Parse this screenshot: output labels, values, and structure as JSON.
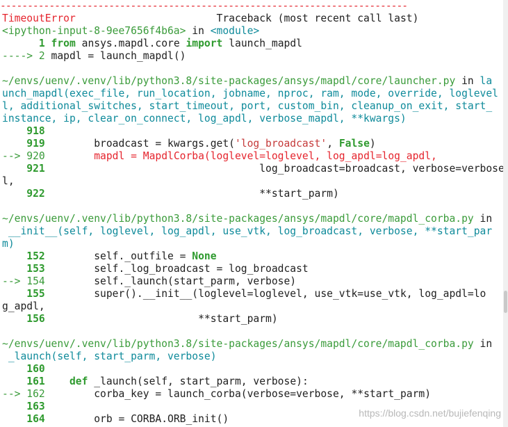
{
  "separator": "---------------------------------------------------------------------------",
  "header": {
    "error_name": "TimeoutError",
    "traceback_label": "Traceback (most recent call last)"
  },
  "frame0": {
    "location": "<ipython-input-8-9ee7656f4b6a>",
    "in_word": " in ",
    "func": "<module>",
    "lines": [
      {
        "arrow": "      ",
        "num": "1",
        "kw1": "from",
        "mod": " ansys.mapdl.core ",
        "kw2": "import",
        "rest": " launch_mapdl"
      },
      {
        "arrow": "----> ",
        "num": "2",
        "code": " mapdl = launch_mapdl()"
      }
    ]
  },
  "frame1": {
    "path": "~/envs/uenv/.venv/lib/python3.8/site-packages/ansys/mapdl/core/launcher.py",
    "in_word": " in ",
    "sig_line1_tail": "la",
    "sig_line2": "unch_mapdl(exec_file, run_location, jobname, nproc, ram, mode, override, loglevel",
    "sig_line3": "l, additional_switches, start_timeout, port, custom_bin, cleanup_on_exit, start_",
    "sig_line4": "instance, ip, clear_on_connect, log_apdl, verbose_mapdl, **kwargs)",
    "lines": [
      {
        "num": "918",
        "code": ""
      },
      {
        "num": "919",
        "code_a": "        broadcast = kwargs.get(",
        "str": "'log_broadcast'",
        "code_b": ", ",
        "kw": "False",
        "code_c": ")"
      },
      {
        "num": "920",
        "arrow": "--> ",
        "code": "        mapdl = MapdlCorba(loglevel=loglevel, log_apdl=log_apdl,"
      },
      {
        "num": "921",
        "code": "                                   log_broadcast=broadcast, verbose=verbose_mapd"
      },
      {
        "cont": "l,"
      },
      {
        "num": "922",
        "code": "                                   **start_parm)"
      }
    ]
  },
  "frame2": {
    "path": "~/envs/uenv/.venv/lib/python3.8/site-packages/ansys/mapdl/core/mapdl_corba.py",
    "in_word": " in",
    "sig_line1": " __init__(self, loglevel, log_apdl, use_vtk, log_broadcast, verbose, **start_par",
    "sig_line2": "m)",
    "lines": [
      {
        "num": "152",
        "code_a": "        self._outfile = ",
        "kw": "None"
      },
      {
        "num": "153",
        "code": "        self._log_broadcast = log_broadcast"
      },
      {
        "num": "154",
        "arrow": "--> ",
        "code": "        self._launch(start_parm, verbose)"
      },
      {
        "num": "155",
        "code": "        super().__init__(loglevel=loglevel, use_vtk=use_vtk, log_apdl=lo"
      },
      {
        "cont": "g_apdl,"
      },
      {
        "num": "156",
        "code": "                         **start_parm)"
      }
    ]
  },
  "frame3": {
    "path": "~/envs/uenv/.venv/lib/python3.8/site-packages/ansys/mapdl/core/mapdl_corba.py",
    "in_word": " in",
    "sig_line1": " _launch(self, start_parm, verbose)",
    "lines": [
      {
        "num": "160",
        "code": ""
      },
      {
        "num": "161",
        "kw": "def",
        "code": " _launch(self, start_parm, verbose):"
      },
      {
        "num": "162",
        "arrow": "--> ",
        "code": "        corba_key = launch_corba(verbose=verbose, **start_parm)"
      },
      {
        "num": "163",
        "code": ""
      },
      {
        "num": "164",
        "code": "        orb = CORBA.ORB_init()"
      }
    ]
  },
  "watermark": "https://blog.csdn.net/bujiefenqing"
}
